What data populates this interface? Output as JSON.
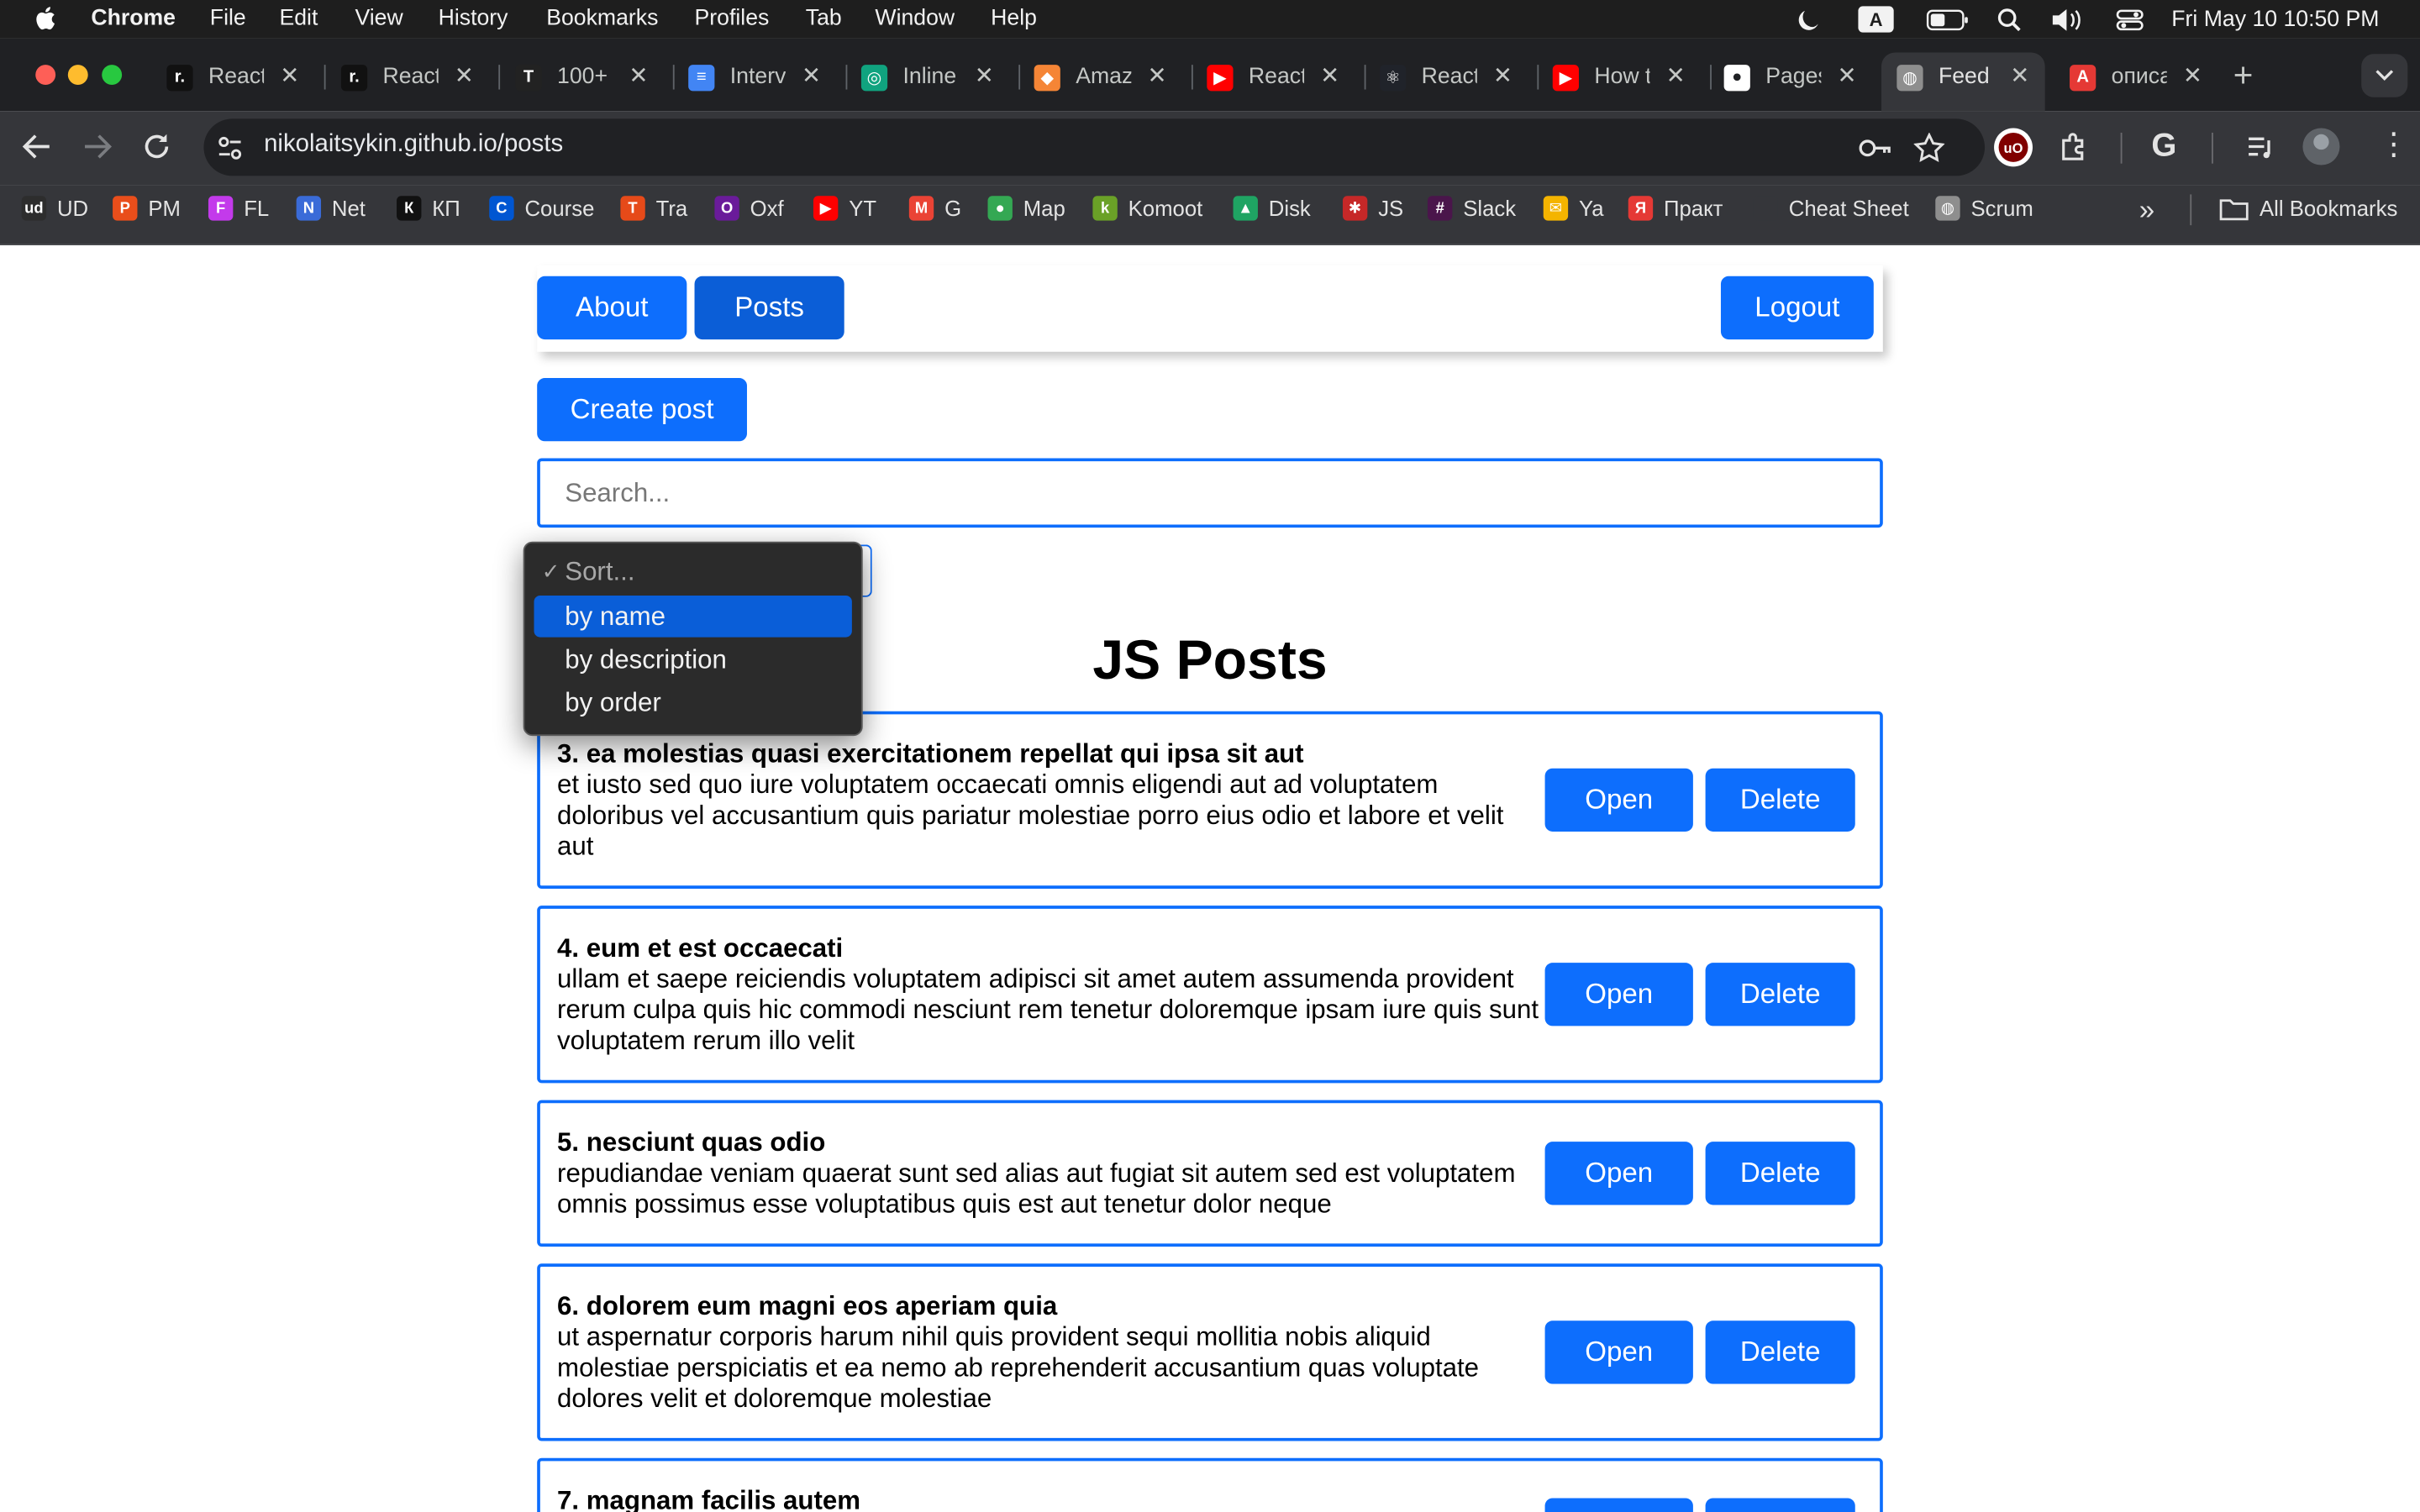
{
  "menubar": {
    "app": "Chrome",
    "items": [
      "File",
      "Edit",
      "View",
      "History",
      "Bookmarks",
      "Profiles",
      "Tab",
      "Window",
      "Help"
    ],
    "input_indicator": "A",
    "clock": "Fri May 10  10:50 PM"
  },
  "tabs": [
    {
      "label": "React",
      "icon": "reactjs-r-favicon",
      "color": "#111111",
      "glyph": "r."
    },
    {
      "label": "React",
      "icon": "reactjs-r-favicon",
      "color": "#111111",
      "glyph": "r."
    },
    {
      "label": "100+",
      "icon": "book-favicon",
      "color": "#222222",
      "glyph": "T"
    },
    {
      "label": "Interv",
      "icon": "google-docs-favicon",
      "color": "#4285f4",
      "glyph": "≡"
    },
    {
      "label": "Inline",
      "icon": "chatgpt-favicon",
      "color": "#10a37f",
      "glyph": "◎"
    },
    {
      "label": "Amaz",
      "icon": "aws-cube-favicon",
      "color": "#f58536",
      "glyph": "◆"
    },
    {
      "label": "React",
      "icon": "youtube-favicon",
      "color": "#ff0000",
      "glyph": "▶"
    },
    {
      "label": "React",
      "icon": "react-atom-favicon",
      "color": "#20232a",
      "glyph": "⚛"
    },
    {
      "label": "How t",
      "icon": "youtube-favicon",
      "color": "#ff0000",
      "glyph": "▶"
    },
    {
      "label": "Pages",
      "icon": "github-favicon",
      "color": "#ffffff",
      "glyph": "●"
    },
    {
      "label": "Feed",
      "icon": "globe-favicon",
      "color": "#8e8e8e",
      "glyph": "◍"
    },
    {
      "label": "описа",
      "icon": "translate-favicon",
      "color": "#e53935",
      "glyph": "A"
    }
  ],
  "toolbar": {
    "url": "nikolaitsykin.github.io/posts"
  },
  "bookmarks": [
    {
      "label": "UD",
      "icon": "ud-icon",
      "color": "#2d2d2d",
      "glyph": "ud"
    },
    {
      "label": "PM",
      "icon": "pm-icon",
      "color": "#e94e1b",
      "glyph": "P"
    },
    {
      "label": "FL",
      "icon": "fl-icon",
      "color": "#c33aeb",
      "glyph": "F"
    },
    {
      "label": "Net",
      "icon": "net-icon",
      "color": "#3a6bd8",
      "glyph": "N"
    },
    {
      "label": "КП",
      "icon": "kp-icon",
      "color": "#111111",
      "glyph": "К"
    },
    {
      "label": "Course",
      "icon": "coursera-icon",
      "color": "#0056d2",
      "glyph": "C"
    },
    {
      "label": "Tra",
      "icon": "tra-icon",
      "color": "#e64a19",
      "glyph": "T"
    },
    {
      "label": "Oxf",
      "icon": "oxford-icon",
      "color": "#6a1b9a",
      "glyph": "O"
    },
    {
      "label": "YT",
      "icon": "youtube-icon",
      "color": "#ff0000",
      "glyph": "▶"
    },
    {
      "label": "G",
      "icon": "gmail-icon",
      "color": "#ea4335",
      "glyph": "M"
    },
    {
      "label": "Map",
      "icon": "maps-icon",
      "color": "#34a853",
      "glyph": "●"
    },
    {
      "label": "Komoot",
      "icon": "komoot-icon",
      "color": "#6aa127",
      "glyph": "k"
    },
    {
      "label": "Disk",
      "icon": "google-drive-icon",
      "color": "#1fa463",
      "glyph": "▲"
    },
    {
      "label": "JS",
      "icon": "js-icon",
      "color": "#c62828",
      "glyph": "✱"
    },
    {
      "label": "Slack",
      "icon": "slack-icon",
      "color": "#4a154b",
      "glyph": "#"
    },
    {
      "label": "Ya",
      "icon": "mail-icon",
      "color": "#f4b400",
      "glyph": "✉"
    },
    {
      "label": "Практ",
      "icon": "yandex-icon",
      "color": "#e53935",
      "glyph": "Я"
    },
    {
      "label": "Cheat Sheet",
      "icon": "cheatsheet-icon",
      "color": "#35363a",
      "glyph": ""
    },
    {
      "label": "Scrum",
      "icon": "globe-icon",
      "color": "#8e8e8e",
      "glyph": "◍"
    }
  ],
  "bookmarks_all": "All Bookmarks",
  "nav": {
    "about": "About",
    "posts": "Posts",
    "logout": "Logout"
  },
  "create_post": "Create post",
  "search": {
    "placeholder": "Search..."
  },
  "sort": {
    "options": [
      "Sort...",
      "by name",
      "by description",
      "by order"
    ],
    "selected_index": 0,
    "highlighted_index": 1
  },
  "page_title": "JS Posts",
  "post_buttons": {
    "open": "Open",
    "delete": "Delete"
  },
  "posts": [
    {
      "title": "3. ea molestias quasi exercitationem repellat qui ipsa sit aut",
      "body": "et iusto sed quo iure voluptatem occaecati omnis eligendi aut ad voluptatem doloribus vel accusantium quis pariatur molestiae porro eius odio et labore et velit aut"
    },
    {
      "title": "4. eum et est occaecati",
      "body": "ullam et saepe reiciendis voluptatem adipisci sit amet autem assumenda provident rerum culpa quis hic commodi nesciunt rem tenetur doloremque ipsam iure quis sunt voluptatem rerum illo velit"
    },
    {
      "title": "5. nesciunt quas odio",
      "body": "repudiandae veniam quaerat sunt sed alias aut fugiat sit autem sed est voluptatem omnis possimus esse voluptatibus quis est aut tenetur dolor neque"
    },
    {
      "title": "6. dolorem eum magni eos aperiam quia",
      "body": "ut aspernatur corporis harum nihil quis provident sequi mollitia nobis aliquid molestiae perspiciatis et ea nemo ab reprehenderit accusantium quas voluptate dolores velit et doloremque molestiae"
    },
    {
      "title": "7. magnam facilis autem",
      "body": ""
    }
  ],
  "colors": {
    "accent": "#0d6efd",
    "dropdown_highlight": "#0a5ed8"
  }
}
